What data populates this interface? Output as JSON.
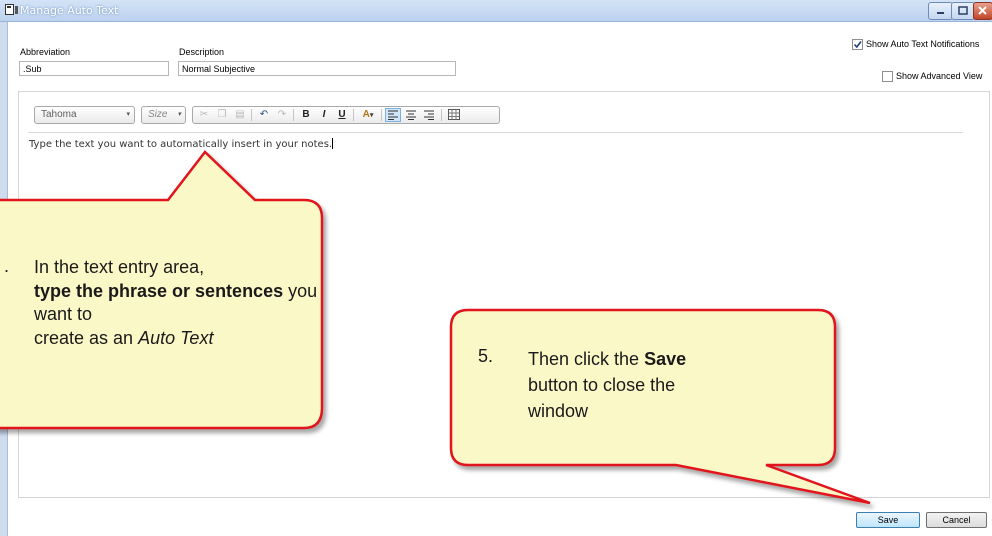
{
  "window": {
    "title": "Manage Auto Text"
  },
  "form": {
    "abbreviation_label": "Abbreviation",
    "abbreviation_value": ".Sub",
    "description_label": "Description",
    "description_value": "Normal Subjective",
    "show_notifications_label": "Show Auto Text Notifications",
    "show_notifications_checked": true,
    "show_advanced_label": "Show Advanced View",
    "show_advanced_checked": false
  },
  "toolbar": {
    "font": "Tahoma",
    "size_placeholder": "Size",
    "bold": "B",
    "italic": "I",
    "underline": "U"
  },
  "editor": {
    "text": "Type the text you want to automatically insert in your notes."
  },
  "callouts": {
    "left": {
      "number": ".",
      "line1": "In the text entry area,",
      "bold": "type the phrase or sentences",
      "line3_rest": " you want to",
      "line4_a": "create as an ",
      "line4_italic": "Auto Text"
    },
    "right": {
      "number": "5.",
      "line1_a": "Then click the ",
      "line1_bold": "Save",
      "line2": "button to close the",
      "line3": "window"
    }
  },
  "buttons": {
    "save": "Save",
    "cancel": "Cancel"
  },
  "colors": {
    "callout_fill": "#fbf8c7",
    "callout_border": "#e0121a",
    "title_text": "#ffffff",
    "accent": "#3c7fb1"
  }
}
